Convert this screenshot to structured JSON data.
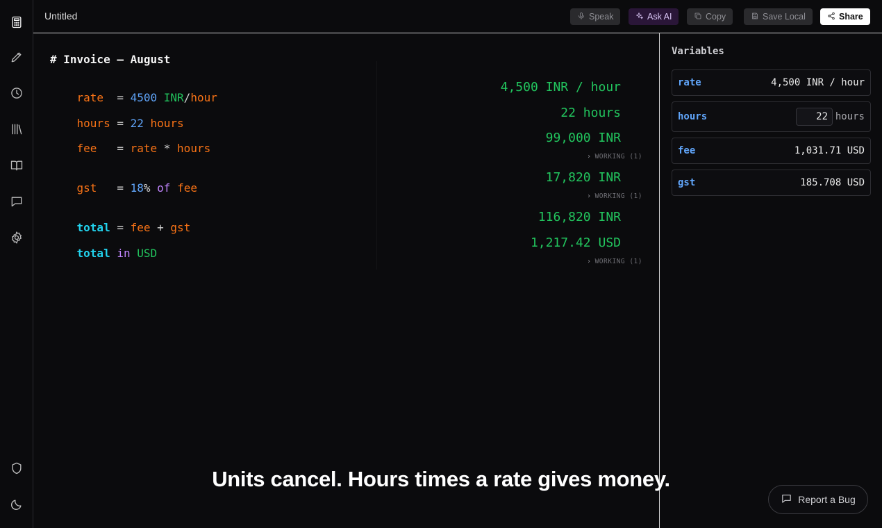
{
  "app": {
    "doc_title": "Untitled"
  },
  "toolbar": {
    "speak_label": "Speak",
    "ask_ai_label": "Ask AI",
    "copy_label": "Copy",
    "save_local_label": "Save Local",
    "share_label": "Share"
  },
  "sidebar": {
    "icons": [
      "calculator-icon",
      "pencil-icon",
      "clock-icon",
      "library-icon",
      "book-icon",
      "chat-icon",
      "gear-icon",
      "shield-icon",
      "moon-icon"
    ]
  },
  "editor": {
    "heading": "# Invoice — August",
    "lines": [
      {
        "tokens": [
          "rate",
          "  = ",
          "4500",
          " ",
          "INR",
          "/",
          "hour"
        ]
      },
      {
        "tokens": [
          "hours",
          " = ",
          "22",
          " ",
          "hours"
        ]
      },
      {
        "tokens": [
          "fee",
          "   = ",
          "rate",
          " * ",
          "hours"
        ]
      },
      {
        "tokens": [
          "gst",
          "   = ",
          "18",
          "%",
          " ",
          "of",
          " ",
          "fee"
        ]
      },
      {
        "tokens": [
          "total",
          " = ",
          "fee",
          " + ",
          "gst"
        ]
      },
      {
        "tokens": [
          "total",
          " ",
          "in",
          " ",
          "USD"
        ]
      }
    ],
    "results": [
      "4,500 INR / hour",
      "22 hours",
      "99,000 INR",
      "17,820 INR",
      "116,820 INR",
      "1,217.42 USD"
    ],
    "working_label": "WORKING (1)"
  },
  "caption": "Units cancel. Hours times a rate gives money.",
  "variables_panel": {
    "title": "Variables",
    "items": [
      {
        "name": "rate",
        "value": "4,500 INR / hour"
      },
      {
        "name": "hours",
        "value": "22",
        "unit": "hours"
      },
      {
        "name": "fee",
        "value": "1,031.71 USD"
      },
      {
        "name": "gst",
        "value": "185.708 USD"
      }
    ]
  },
  "report_bug_label": "Report a Bug",
  "colors": {
    "variable": "#f97316",
    "number": "#60a5fa",
    "unit": "#22c55e",
    "keyword": "#c084fc",
    "total": "#22d3ee",
    "result": "#22c55e"
  }
}
